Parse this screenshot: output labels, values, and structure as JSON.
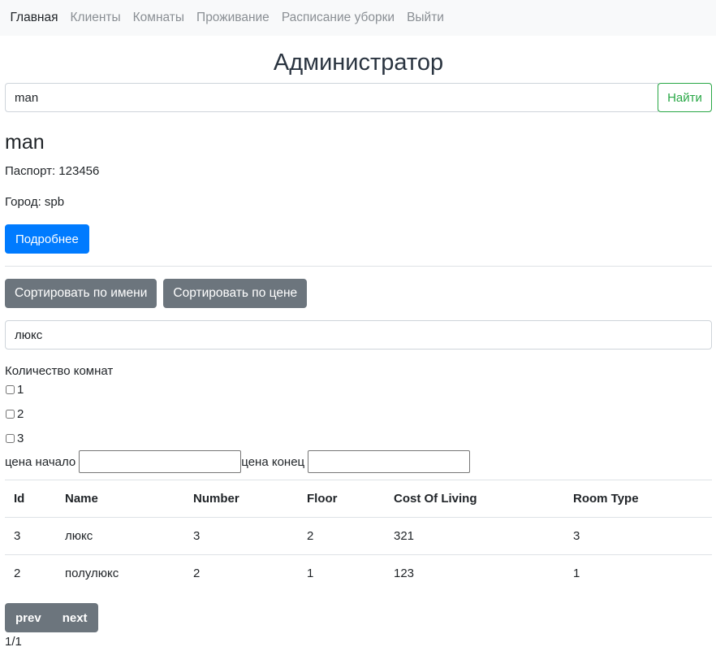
{
  "nav": {
    "items": [
      "Главная",
      "Клиенты",
      "Комнаты",
      "Проживание",
      "Расписание уборки",
      "Выйти"
    ]
  },
  "header": {
    "title": "Администратор"
  },
  "search": {
    "value": "man",
    "button": "Найти"
  },
  "client": {
    "name": "man",
    "passport": "Паспорт: 123456",
    "city": "Город: spb",
    "details_button": "Подробнее"
  },
  "sort": {
    "by_name": "Сортировать по имени",
    "by_price": "Сортировать по цене"
  },
  "filter": {
    "type_value": "люкс",
    "rooms_label": "Количество комнат",
    "options": [
      "1",
      "2",
      "3"
    ],
    "price_start_label": "цена начало",
    "price_end_label": "цена конец",
    "price_start_value": "",
    "price_end_value": ""
  },
  "table": {
    "headers": [
      "Id",
      "Name",
      "Number",
      "Floor",
      "Cost Of Living",
      "Room Type"
    ],
    "rows": [
      [
        "3",
        "люкс",
        "3",
        "2",
        "321",
        "3"
      ],
      [
        "2",
        "полулюкс",
        "2",
        "1",
        "123",
        "1"
      ]
    ]
  },
  "pagination": {
    "prev": "prev",
    "next": "next",
    "status": "1/1"
  },
  "colors": {
    "primary": "#007bff",
    "secondary": "#6c757d",
    "success": "#28a745"
  }
}
